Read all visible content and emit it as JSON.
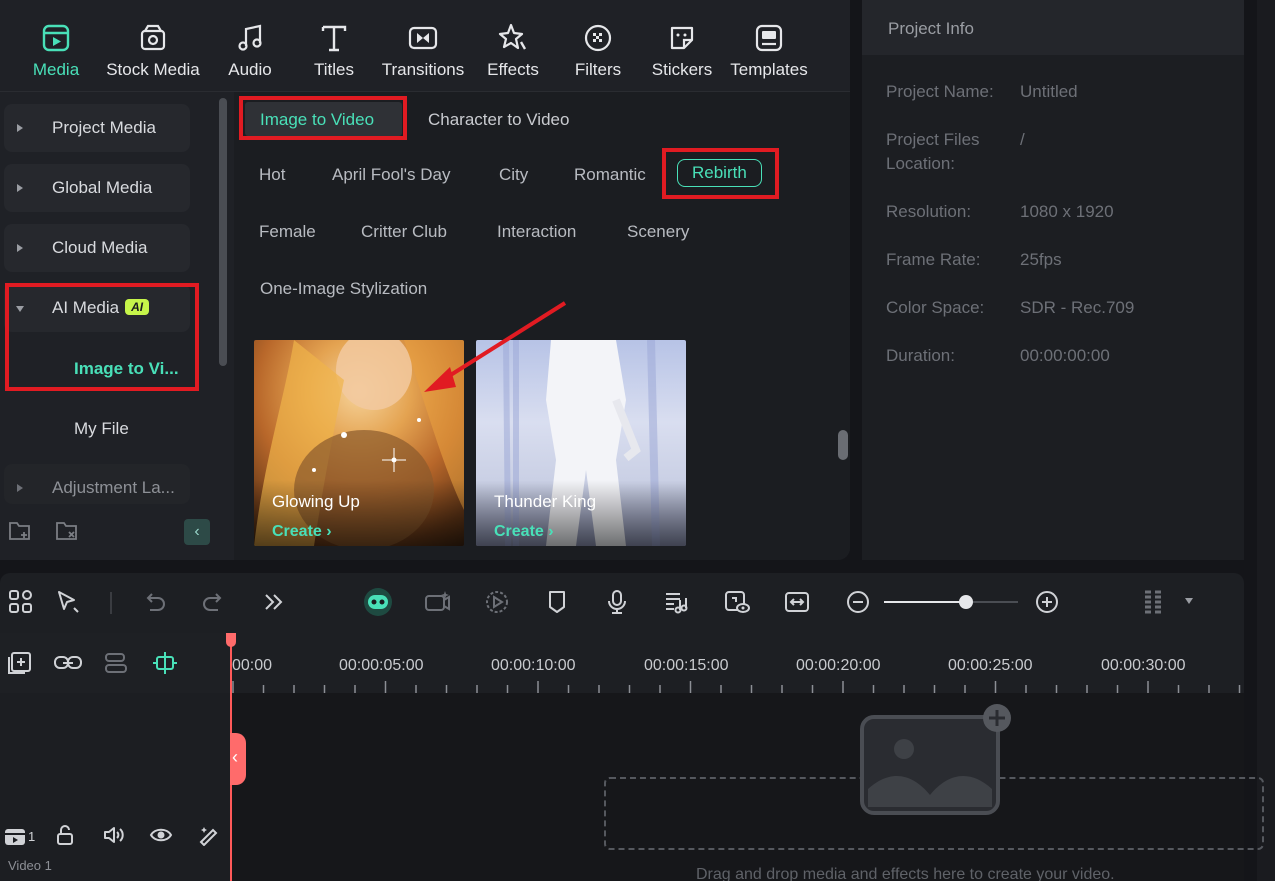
{
  "top_tabs": [
    {
      "label": "Media",
      "icon": "media-icon",
      "active": true
    },
    {
      "label": "Stock Media",
      "icon": "stock-media-icon"
    },
    {
      "label": "Audio",
      "icon": "music-note-icon"
    },
    {
      "label": "Titles",
      "icon": "titles-icon"
    },
    {
      "label": "Transitions",
      "icon": "transitions-icon"
    },
    {
      "label": "Effects",
      "icon": "effects-icon"
    },
    {
      "label": "Filters",
      "icon": "filters-icon"
    },
    {
      "label": "Stickers",
      "icon": "stickers-icon"
    },
    {
      "label": "Templates",
      "icon": "templates-icon"
    }
  ],
  "sidebar": {
    "items": [
      {
        "label": "Project Media"
      },
      {
        "label": "Global Media"
      },
      {
        "label": "Cloud Media"
      },
      {
        "label": "AI Media",
        "badge": "AI",
        "expanded": true
      }
    ],
    "sub_items": [
      {
        "label": "Image to Vi...",
        "active": true
      },
      {
        "label": "My File"
      }
    ],
    "partial_item": "Adjustment La..."
  },
  "content": {
    "sub_tabs": [
      "Image to Video",
      "Character to Video"
    ],
    "categories_row1": [
      "Hot",
      "April Fool's Day",
      "City",
      "Romantic",
      "Rebirth"
    ],
    "categories_row2": [
      "Female",
      "Critter Club",
      "Interaction",
      "Scenery"
    ],
    "categories_row3": [
      "One-Image Stylization"
    ],
    "selected_category": "Rebirth",
    "cards": [
      {
        "title": "Glowing Up",
        "action": "Create"
      },
      {
        "title": "Thunder King",
        "action": "Create"
      }
    ]
  },
  "project_info": {
    "header": "Project Info",
    "rows": [
      {
        "label": "Project Name:",
        "value": "Untitled"
      },
      {
        "label": "Project Files",
        "label2": "Location:",
        "value": "/"
      },
      {
        "label": "Resolution:",
        "value": "1080 x 1920"
      },
      {
        "label": "Frame Rate:",
        "value": "25fps"
      },
      {
        "label": "Color Space:",
        "value": "SDR - Rec.709"
      },
      {
        "label": "Duration:",
        "value": "00:00:00:00"
      }
    ]
  },
  "timeline": {
    "ticks": [
      "00:00",
      "00:00:05:00",
      "00:00:10:00",
      "00:00:15:00",
      "00:00:20:00",
      "00:00:25:00",
      "00:00:30:00"
    ],
    "track_number": "1",
    "track_label": "Video 1",
    "drop_text": "Drag and drop media and effects here to create your video."
  },
  "colors": {
    "accent": "#49e0b8",
    "highlight": "#e11b22",
    "ai_badge": "#c6f54a"
  }
}
